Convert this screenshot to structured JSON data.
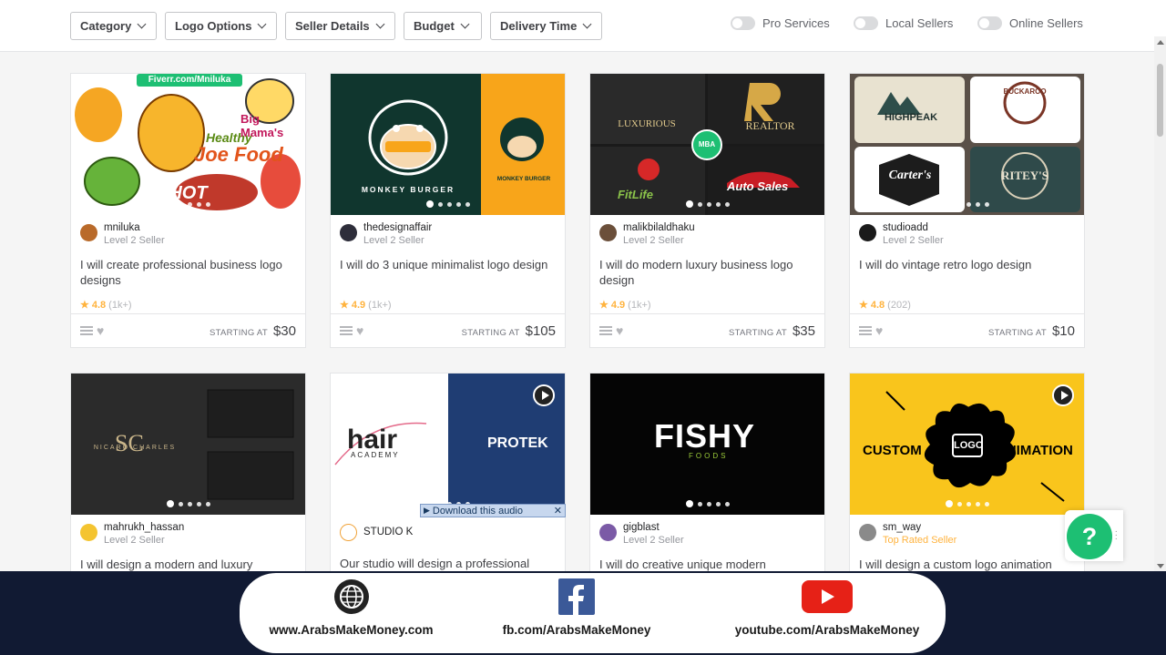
{
  "filters": [
    {
      "label": "Category"
    },
    {
      "label": "Logo Options"
    },
    {
      "label": "Seller Details"
    },
    {
      "label": "Budget"
    },
    {
      "label": "Delivery Time"
    }
  ],
  "toggles": [
    {
      "label": "Pro Services"
    },
    {
      "label": "Local Sellers"
    },
    {
      "label": "Online Sellers"
    }
  ],
  "gigs": [
    {
      "seller": "mniluka",
      "level": "Level 2 Seller",
      "title": "I will create professional business logo designs",
      "rating": "4.8",
      "reviews": "(1k+)",
      "price_label": "STARTING AT",
      "price": "$30",
      "thumb_text": [
        "Fiverr.com/Mniluka",
        "Healthy",
        "Joe Food",
        "Big Mama's",
        "SHOT"
      ]
    },
    {
      "seller": "thedesignaffair",
      "level": "Level 2 Seller",
      "title": "I will do 3 unique minimalist logo design",
      "rating": "4.9",
      "reviews": "(1k+)",
      "price_label": "STARTING AT",
      "price": "$105",
      "thumb_text": [
        "MONKEY BURGER",
        "MONKEY BURGER"
      ]
    },
    {
      "seller": "malikbilaldhaku",
      "level": "Level 2 Seller",
      "title": "I will do modern luxury business logo design",
      "rating": "4.9",
      "reviews": "(1k+)",
      "price_label": "STARTING AT",
      "price": "$35",
      "thumb_text": [
        "LUXURIOUS",
        "REALTOR",
        "FitLife",
        "Auto Sales",
        "MBA"
      ]
    },
    {
      "seller": "studioadd",
      "level": "Level 2 Seller",
      "title": "I will do vintage retro logo design",
      "rating": "4.8",
      "reviews": "(202)",
      "price_label": "STARTING AT",
      "price": "$10",
      "thumb_text": [
        "HIGHPEAK",
        "BUCKAROO",
        "Carter's",
        "RITEY'S"
      ]
    },
    {
      "seller": "mahrukh_hassan",
      "level": "Level 2 Seller",
      "title": "I will design a modern and luxury",
      "thumb_text": [
        "NICARO CHARLES",
        "SC"
      ]
    },
    {
      "seller": "STUDIO K",
      "level": "",
      "title": "Our studio will design a professional",
      "thumb_text": [
        "hair",
        "ACADEMY",
        "PROTEK"
      ]
    },
    {
      "seller": "gigblast",
      "level": "Level 2 Seller",
      "title": "I will do creative unique modern",
      "thumb_text": [
        "FISHY",
        "FOODS"
      ]
    },
    {
      "seller": "sm_way",
      "level": "Top Rated Seller",
      "title": "I will design a custom logo animation",
      "thumb_text": [
        "CUSTOM",
        "LOGO",
        "ANIMATION"
      ]
    }
  ],
  "download_audio": "Download this audio",
  "help_label": "?",
  "banner": [
    {
      "text": "www.ArabsMakeMoney.com",
      "icon": "globe-icon"
    },
    {
      "text": "fb.com/ArabsMakeMoney",
      "icon": "facebook-icon"
    },
    {
      "text": "youtube.com/ArabsMakeMoney",
      "icon": "youtube-icon"
    }
  ],
  "colors": {
    "accent": "#1dbf73",
    "star": "#ffb33e",
    "banner_bg": "#111a33"
  }
}
